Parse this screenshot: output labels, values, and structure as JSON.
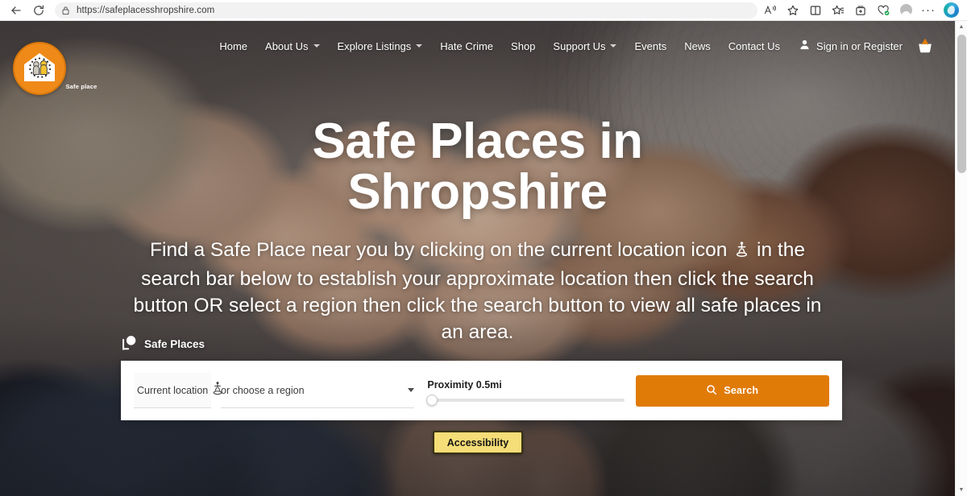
{
  "browser": {
    "back_label": "Back",
    "refresh_label": "Refresh",
    "url_scheme": "https://",
    "url_host": "safeplacesshropshire.com",
    "url_full": "https://safeplacesshropshire.com",
    "lock_icon": "lock-icon",
    "toolbar_icons": [
      {
        "name": "read-aloud-icon",
        "label": "Read aloud"
      },
      {
        "name": "favorite-star-icon",
        "label": "Add this page to favorites"
      },
      {
        "name": "split-screen-icon",
        "label": "Split screen"
      },
      {
        "name": "favorites-icon",
        "label": "Favorites"
      },
      {
        "name": "collections-icon",
        "label": "Collections"
      },
      {
        "name": "browser-essentials-icon",
        "label": "Browser essentials"
      },
      {
        "name": "profile-avatar-icon",
        "label": "Profile"
      },
      {
        "name": "settings-more-icon",
        "label": "Settings and more"
      },
      {
        "name": "copilot-icon",
        "label": "Copilot"
      }
    ]
  },
  "site": {
    "logo": {
      "name": "safe-place-logo",
      "caption": "Safe place",
      "circle_color": "#ef8a18"
    },
    "nav": [
      {
        "label": "Home",
        "has_dropdown": false
      },
      {
        "label": "About Us",
        "has_dropdown": true
      },
      {
        "label": "Explore Listings",
        "has_dropdown": true
      },
      {
        "label": "Hate Crime",
        "has_dropdown": false
      },
      {
        "label": "Shop",
        "has_dropdown": false
      },
      {
        "label": "Support Us",
        "has_dropdown": true
      },
      {
        "label": "Events",
        "has_dropdown": false
      },
      {
        "label": "News",
        "has_dropdown": false
      },
      {
        "label": "Contact Us",
        "has_dropdown": false
      }
    ],
    "account": {
      "label": "Sign in or Register",
      "person_icon": "person-icon",
      "basket_icon": "shopping-basket-icon"
    }
  },
  "hero": {
    "title_line1": "Safe Places in",
    "title_line2": "Shropshire",
    "subtitle_part1": "Find a Safe Place near you by clicking on the current location icon",
    "subtitle_part2": "in the search bar below to establish your approximate location then click the search button OR select a region then click the search button to view all safe places in an area.",
    "safe_places_label": "Safe Places",
    "map_pin_icon": "map-pin-icon"
  },
  "search": {
    "current_location_label": "Current location",
    "current_location_icon": "accessibility-location-icon",
    "region_label": "or choose a region",
    "region_caret_icon": "chevron-down-icon",
    "proximity_label": "Proximity 0.5mi",
    "proximity_value": 0.5,
    "proximity_unit": "mi",
    "proximity_percent": 0,
    "search_button_label": "Search",
    "search_icon": "search-icon",
    "accent_color": "#e07b08"
  },
  "accessibility": {
    "button_label": "Accessibility",
    "background_color": "#f5dd77",
    "border_color": "#3a3214"
  },
  "scrollbar": {
    "up_arrow": "▲",
    "down_arrow": "▼"
  }
}
